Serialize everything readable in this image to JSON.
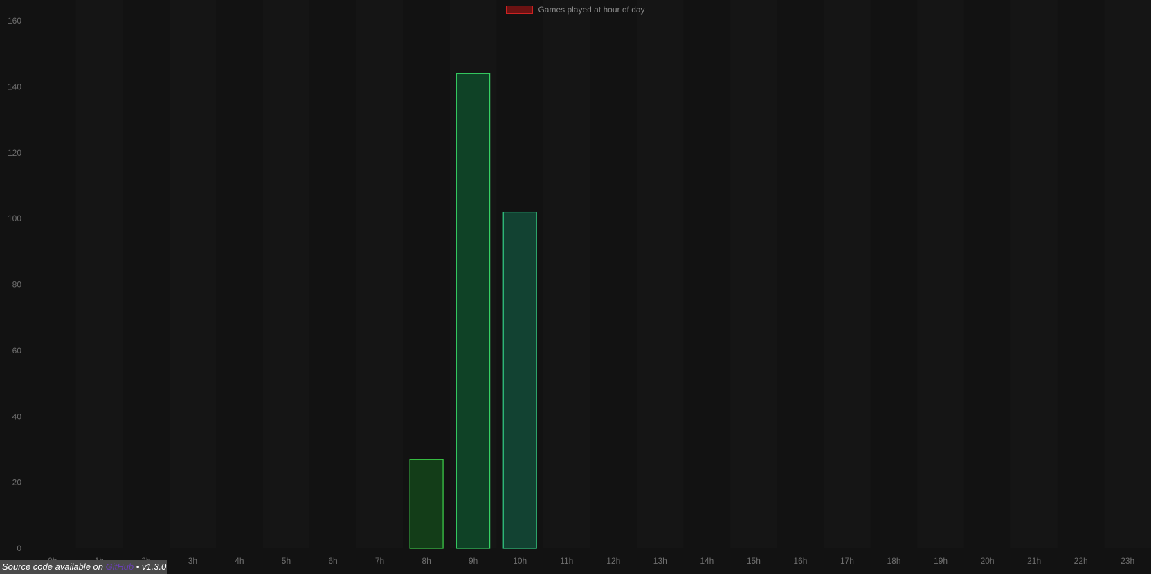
{
  "chart_data": {
    "type": "bar",
    "categories": [
      "0h",
      "1h",
      "2h",
      "3h",
      "4h",
      "5h",
      "6h",
      "7h",
      "8h",
      "9h",
      "10h",
      "11h",
      "12h",
      "13h",
      "14h",
      "15h",
      "16h",
      "17h",
      "18h",
      "19h",
      "20h",
      "21h",
      "22h",
      "23h"
    ],
    "series": [
      {
        "name": "Games played at hour of day",
        "values": [
          0,
          0,
          0,
          0,
          0,
          0,
          0,
          0,
          27,
          144,
          102,
          0,
          0,
          0,
          0,
          0,
          0,
          0,
          0,
          0,
          0,
          0,
          0,
          0
        ]
      }
    ],
    "ylim": [
      0,
      160
    ],
    "yticks": [
      0,
      20,
      40,
      60,
      80,
      100,
      120,
      140,
      160
    ],
    "grid": true,
    "legend": "top-center",
    "colors": {
      "background": "#121212",
      "bar_fills": {
        "8h": "#133d18",
        "9h": "#0f4226",
        "10h": "#124232"
      },
      "bar_borders": {
        "8h": "#3ed14a",
        "9h": "#37d565",
        "10h": "#34cf86"
      },
      "legend_swatch_fill": "#6b1212",
      "legend_swatch_border": "#cc2222",
      "tick_label": "#6e6e6e"
    }
  },
  "legend": {
    "label": "Games played at hour of day"
  },
  "footer": {
    "text_before": "Source code available on ",
    "link_label": "GitHub",
    "text_after": " • v1.3.0"
  }
}
